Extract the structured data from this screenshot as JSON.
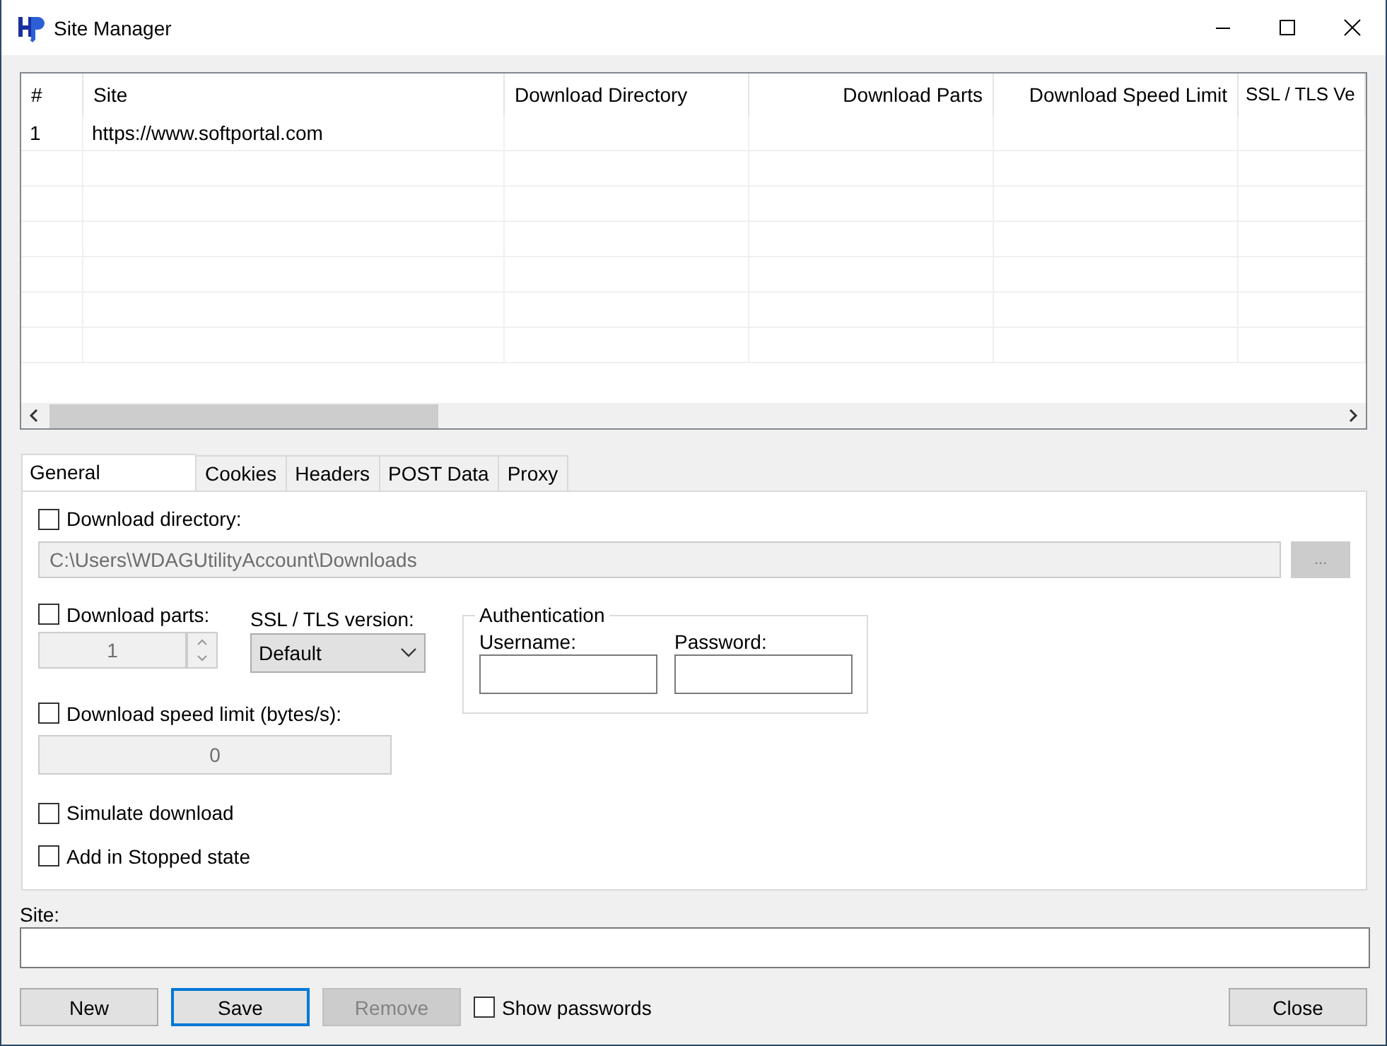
{
  "window": {
    "title": "Site Manager"
  },
  "table": {
    "columns": [
      {
        "label": "#"
      },
      {
        "label": "Site"
      },
      {
        "label": "Download Directory"
      },
      {
        "label": "Download Parts"
      },
      {
        "label": "Download Speed Limit"
      },
      {
        "label": "SSL / TLS Ve"
      }
    ],
    "rows": [
      {
        "number": "1",
        "site": "https://www.softportal.com"
      }
    ]
  },
  "tabs": [
    {
      "label": "General",
      "selected": true
    },
    {
      "label": "Cookies",
      "selected": false
    },
    {
      "label": "Headers",
      "selected": false
    },
    {
      "label": "POST Data",
      "selected": false
    },
    {
      "label": "Proxy",
      "selected": false
    }
  ],
  "general": {
    "download_directory": {
      "label": "Download directory:",
      "checked": false
    },
    "directory_field": {
      "value": "C:\\Users\\WDAGUtilityAccount\\Downloads",
      "disabled": true
    },
    "browse_button": {
      "label": "...",
      "disabled": true
    },
    "download_parts": {
      "label": "Download parts:",
      "checked": false
    },
    "parts_spinner": {
      "value": "1",
      "disabled": true
    },
    "ssl_tls": {
      "label": "SSL / TLS version:",
      "value": "Default"
    },
    "authentication": {
      "title": "Authentication",
      "username_label": "Username:",
      "password_label": "Password:"
    },
    "speed_limit": {
      "label": "Download speed limit (bytes/s):",
      "checked": false
    },
    "speed_field": {
      "value": "0",
      "disabled": true
    },
    "simulate_download": {
      "label": "Simulate download",
      "checked": false
    },
    "add_stopped": {
      "label": "Add in Stopped state",
      "checked": false
    }
  },
  "site_field": {
    "label": "Site:"
  },
  "buttons": [
    {
      "label": "New",
      "disabled": false,
      "default": false
    },
    {
      "label": "Save",
      "disabled": false,
      "default": true
    },
    {
      "label": "Remove",
      "disabled": true,
      "default": false
    }
  ],
  "show_passwords": {
    "label": "Show passwords",
    "checked": false
  },
  "close_button": {
    "label": "Close"
  }
}
